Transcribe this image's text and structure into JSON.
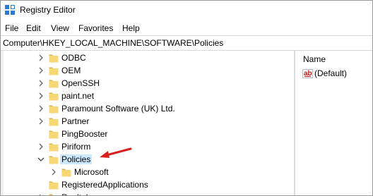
{
  "window": {
    "title": "Registry Editor"
  },
  "menu": [
    "File",
    "Edit",
    "View",
    "Favorites",
    "Help"
  ],
  "address": "Computer\\HKEY_LOCAL_MACHINE\\SOFTWARE\\Policies",
  "tree": {
    "items": [
      {
        "label": "ODBC",
        "expander": "collapsed",
        "level": 1
      },
      {
        "label": "OEM",
        "expander": "collapsed",
        "level": 1
      },
      {
        "label": "OpenSSH",
        "expander": "collapsed",
        "level": 1
      },
      {
        "label": "paint.net",
        "expander": "collapsed",
        "level": 1
      },
      {
        "label": "Paramount Software (UK) Ltd.",
        "expander": "collapsed",
        "level": 1
      },
      {
        "label": "Partner",
        "expander": "collapsed",
        "level": 1
      },
      {
        "label": "PingBooster",
        "expander": "none",
        "level": 1
      },
      {
        "label": "Piriform",
        "expander": "collapsed",
        "level": 1
      },
      {
        "label": "Policies",
        "expander": "expanded",
        "level": 1,
        "selected": true
      },
      {
        "label": "Microsoft",
        "expander": "collapsed",
        "level": 2
      },
      {
        "label": "RegisteredApplications",
        "expander": "none",
        "level": 1
      },
      {
        "label": "Realtek",
        "expander": "collapsed",
        "level": 1
      }
    ]
  },
  "values_pane": {
    "column_name": "Name",
    "rows": [
      {
        "icon": "string-value-icon",
        "name": "(Default)"
      }
    ]
  },
  "colors": {
    "folder": "#f8d775",
    "folder_dark": "#e0b34a",
    "selection": "#cce8ff",
    "annotation_arrow": "#d9201f"
  }
}
